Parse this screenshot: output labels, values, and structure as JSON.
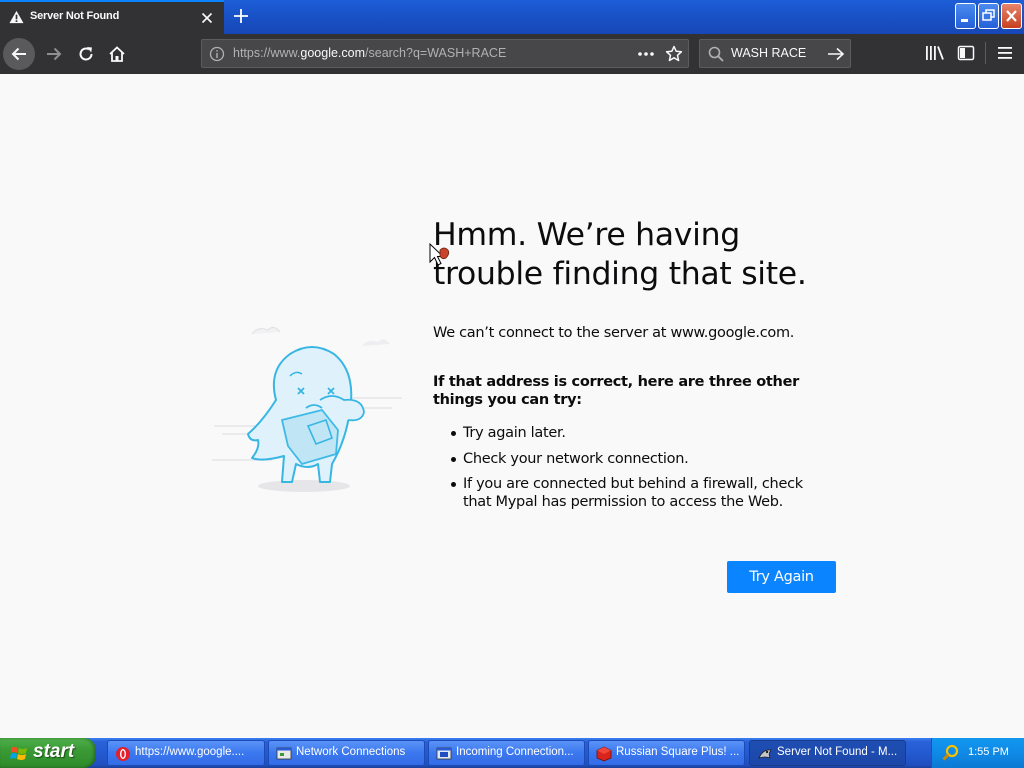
{
  "tab": {
    "title": "Server Not Found",
    "warning_icon": "warning-triangle-icon"
  },
  "urlbar": {
    "url_prefix": "https://www.",
    "url_host": "google.com",
    "url_suffix": "/search?q=WASH+RACE"
  },
  "searchbar": {
    "value": "WASH RACE"
  },
  "error": {
    "title": "Hmm. We’re having trouble finding that site.",
    "description": "We can’t connect to the server at www.google.com.",
    "suggestions_heading": "If that address is correct, here are three other things you can try:",
    "suggestions": [
      "Try again later.",
      "Check your network connection.",
      "If you are connected but behind a firewall, check that Mypal has permission to access the Web."
    ],
    "try_again_label": "Try Again"
  },
  "taskbar": {
    "start_label": "start",
    "tasks": [
      {
        "label": "https://www.google....",
        "icon": "opera-icon"
      },
      {
        "label": "Network Connections",
        "icon": "network-connections-icon"
      },
      {
        "label": "Incoming Connection...",
        "icon": "connection-window-icon"
      },
      {
        "label": "Russian Square Plus! ...",
        "icon": "game-cube-icon"
      },
      {
        "label": "Server Not Found - M...",
        "icon": "mypal-icon"
      }
    ],
    "clock": "1:55 PM"
  },
  "colors": {
    "accent_blue": "#0a84ff",
    "toolbar_dark": "#323234",
    "page_bg": "#f9f9fa",
    "xp_taskbar_blue": "#245ad1",
    "xp_start_green": "#3a9a35"
  }
}
